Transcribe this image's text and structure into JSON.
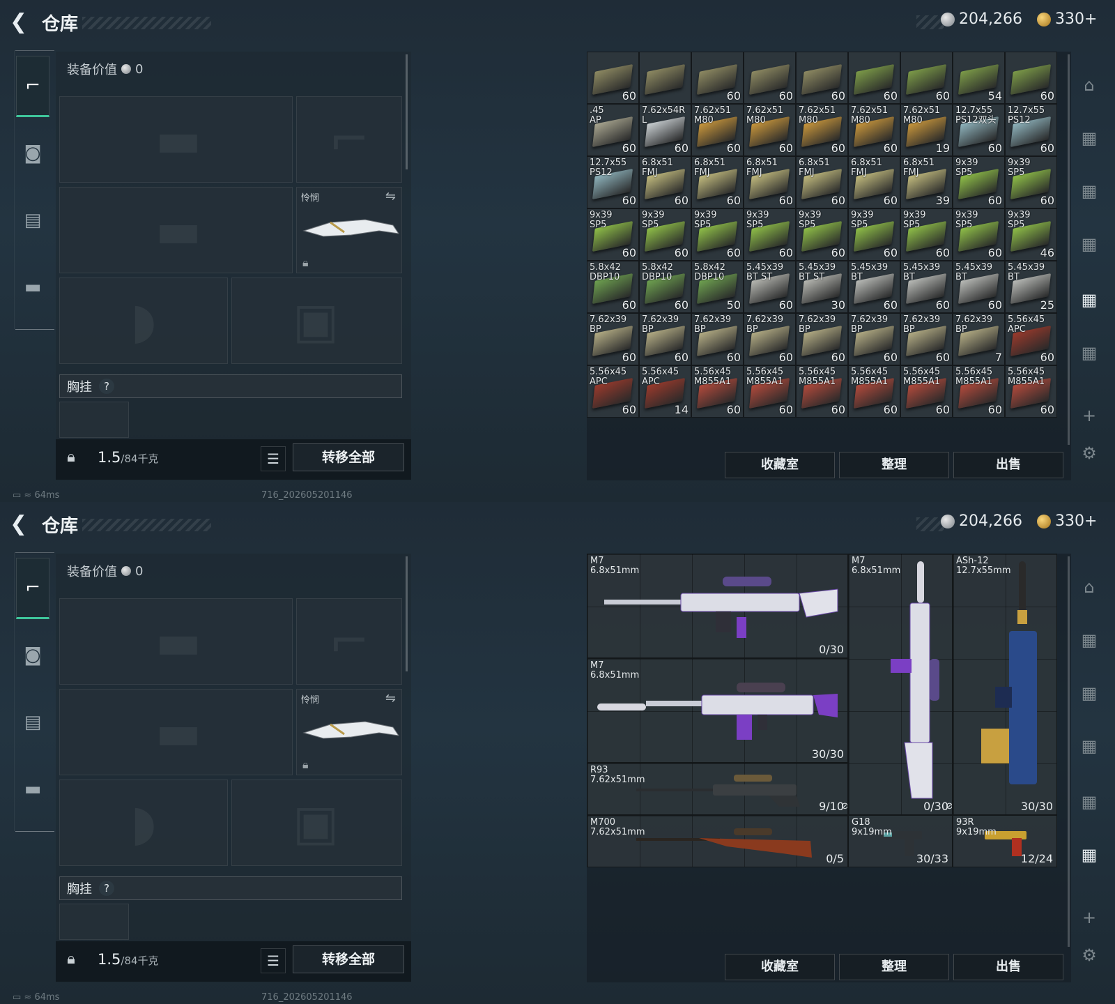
{
  "header": {
    "title": "仓库",
    "silver": "204,266",
    "gold": "330+"
  },
  "equipment": {
    "value_label": "装备价值",
    "value": "0",
    "melee_label": "怜悯",
    "rig_label": "胸挂",
    "rig_help": "?",
    "weight_current": "1.5",
    "weight_max": "/84千克",
    "transfer_all": "转移全部"
  },
  "status": {
    "latency": "64ms",
    "build": "716_202605201146"
  },
  "actions": {
    "collection": "收藏室",
    "sort": "整理",
    "sell": "出售"
  },
  "ammo_grid": [
    {
      "name": "",
      "count": "60",
      "color": "#8e8a62"
    },
    {
      "name": "",
      "count": "",
      "color": "#8e8a62"
    },
    {
      "name": "",
      "count": "60",
      "color": "#8e8a62"
    },
    {
      "name": "",
      "count": "60",
      "color": "#8e8a62"
    },
    {
      "name": "",
      "count": "60",
      "color": "#8e8a62"
    },
    {
      "name": "",
      "count": "60",
      "color": "#7c9b48"
    },
    {
      "name": "",
      "count": "60",
      "color": "#7c9b48"
    },
    {
      "name": "",
      "count": "54",
      "color": "#7c9b48"
    },
    {
      "name": "",
      "count": "60",
      "color": "#7c9b48"
    },
    {
      "name": ".45\nAP",
      "count": "60",
      "color": "#a9a690"
    },
    {
      "name": "7.62x54R\nL",
      "count": "60",
      "color": "#c9cfd2"
    },
    {
      "name": "7.62x51\nM80",
      "count": "60",
      "color": "#c8963c"
    },
    {
      "name": "7.62x51\nM80",
      "count": "60",
      "color": "#c8963c"
    },
    {
      "name": "7.62x51\nM80",
      "count": "60",
      "color": "#c8963c"
    },
    {
      "name": "7.62x51\nM80",
      "count": "60",
      "color": "#c8963c"
    },
    {
      "name": "7.62x51\nM80",
      "count": "19",
      "color": "#c8963c"
    },
    {
      "name": "12.7x55\nPS12双头",
      "count": "60",
      "color": "#8fb4bd"
    },
    {
      "name": "12.7x55\nPS12",
      "count": "60",
      "color": "#8fb4bd"
    },
    {
      "name": "12.7x55\nPS12",
      "count": "60",
      "color": "#8fb4bd"
    },
    {
      "name": "6.8x51\nFMJ",
      "count": "60",
      "color": "#c2bb7e"
    },
    {
      "name": "6.8x51\nFMJ",
      "count": "60",
      "color": "#c2bb7e"
    },
    {
      "name": "6.8x51\nFMJ",
      "count": "60",
      "color": "#c2bb7e"
    },
    {
      "name": "6.8x51\nFMJ",
      "count": "60",
      "color": "#c2bb7e"
    },
    {
      "name": "6.8x51\nFMJ",
      "count": "60",
      "color": "#c2bb7e"
    },
    {
      "name": "6.8x51\nFMJ",
      "count": "39",
      "color": "#c2bb7e"
    },
    {
      "name": "9x39\nSP5",
      "count": "60",
      "color": "#8fbf48"
    },
    {
      "name": "9x39\nSP5",
      "count": "60",
      "color": "#8fbf48"
    },
    {
      "name": "9x39\nSP5",
      "count": "60",
      "color": "#8fbf48"
    },
    {
      "name": "9x39\nSP5",
      "count": "60",
      "color": "#8fbf48"
    },
    {
      "name": "9x39\nSP5",
      "count": "60",
      "color": "#8fbf48"
    },
    {
      "name": "9x39\nSP5",
      "count": "60",
      "color": "#8fbf48"
    },
    {
      "name": "9x39\nSP5",
      "count": "60",
      "color": "#8fbf48"
    },
    {
      "name": "9x39\nSP5",
      "count": "60",
      "color": "#8fbf48"
    },
    {
      "name": "9x39\nSP5",
      "count": "60",
      "color": "#8fbf48"
    },
    {
      "name": "9x39\nSP5",
      "count": "60",
      "color": "#8fbf48"
    },
    {
      "name": "9x39\nSP5",
      "count": "46",
      "color": "#8fbf48"
    },
    {
      "name": "5.8x42\nDBP10",
      "count": "60",
      "color": "#6ea150"
    },
    {
      "name": "5.8x42\nDBP10",
      "count": "60",
      "color": "#6ea150"
    },
    {
      "name": "5.8x42\nDBP10",
      "count": "50",
      "color": "#6ea150"
    },
    {
      "name": "5.45x39\nBT ST",
      "count": "60",
      "color": "#b7b8b2"
    },
    {
      "name": "5.45x39\nBT ST",
      "count": "30",
      "color": "#b7b8b2"
    },
    {
      "name": "5.45x39\nBT",
      "count": "60",
      "color": "#b9bbb7"
    },
    {
      "name": "5.45x39\nBT",
      "count": "60",
      "color": "#b9bbb7"
    },
    {
      "name": "5.45x39\nBT",
      "count": "60",
      "color": "#b9bbb7"
    },
    {
      "name": "5.45x39\nBT",
      "count": "25",
      "color": "#b9bbb7"
    },
    {
      "name": "7.62x39\nBP",
      "count": "60",
      "color": "#b4ad85"
    },
    {
      "name": "7.62x39\nBP",
      "count": "60",
      "color": "#b4ad85"
    },
    {
      "name": "7.62x39\nBP",
      "count": "60",
      "color": "#b4ad85"
    },
    {
      "name": "7.62x39\nBP",
      "count": "60",
      "color": "#b4ad85"
    },
    {
      "name": "7.62x39\nBP",
      "count": "60",
      "color": "#b4ad85"
    },
    {
      "name": "7.62x39\nBP",
      "count": "60",
      "color": "#b4ad85"
    },
    {
      "name": "7.62x39\nBP",
      "count": "60",
      "color": "#b4ad85"
    },
    {
      "name": "7.62x39\nBP",
      "count": "7",
      "color": "#b4ad85"
    },
    {
      "name": "5.56x45\nAPC",
      "count": "60",
      "color": "#9a3a2c"
    },
    {
      "name": "5.56x45\nAPC",
      "count": "60",
      "color": "#9a3a2c"
    },
    {
      "name": "5.56x45\nAPC",
      "count": "14",
      "color": "#9a3a2c"
    },
    {
      "name": "5.56x45\nM855A1",
      "count": "60",
      "color": "#b24a3c"
    },
    {
      "name": "5.56x45\nM855A1",
      "count": "60",
      "color": "#b24a3c"
    },
    {
      "name": "5.56x45\nM855A1",
      "count": "60",
      "color": "#b24a3c"
    },
    {
      "name": "5.56x45\nM855A1",
      "count": "60",
      "color": "#b24a3c"
    },
    {
      "name": "5.56x45\nM855A1",
      "count": "60",
      "color": "#b24a3c"
    },
    {
      "name": "5.56x45\nM855A1",
      "count": "60",
      "color": "#b24a3c"
    },
    {
      "name": "5.56x45\nM855A1",
      "count": "60",
      "color": "#b24a3c"
    }
  ],
  "weapons": [
    {
      "name": "M7\n6.8x51mm",
      "ammo": "0/30",
      "color": "#d9d9e3",
      "accent": "#7b3fc4"
    },
    {
      "name": "M7\n6.8x51mm",
      "ammo": "30/30",
      "color": "#d9d9e3",
      "accent": "#7b3fc4"
    },
    {
      "name": "R93\n7.62x51mm",
      "ammo": "9/10",
      "color": "#3b3f42",
      "accent": "#6b5a3a"
    },
    {
      "name": "M700\n7.62x51mm",
      "ammo": "0/5",
      "color": "#8a3a1e",
      "accent": "#4a3a2a"
    },
    {
      "name": "M7\n6.8x51mm",
      "ammo": "0/30",
      "color": "#d9d9e3",
      "accent": "#7b3fc4"
    },
    {
      "name": "ASh-12\n12.7x55mm",
      "ammo": "30/30",
      "color": "#2a4a8a",
      "accent": "#c8a040"
    },
    {
      "name": "G18\n9x19mm",
      "ammo": "30/33",
      "color": "#2d3236",
      "accent": "#5aa0a0"
    },
    {
      "name": "93R\n9x19mm",
      "ammo": "12/24",
      "color": "#c9a030",
      "accent": "#b03020"
    }
  ]
}
